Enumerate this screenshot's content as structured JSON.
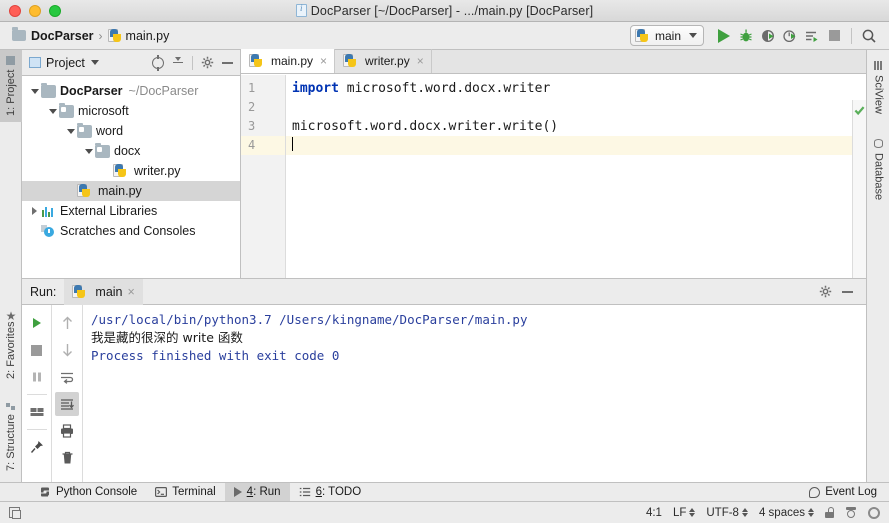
{
  "window": {
    "title": "DocParser [~/DocParser] - .../main.py [DocParser]",
    "title_icon": "file-info-icon",
    "traffic_lights": [
      "close-button",
      "minimize-button",
      "zoom-button"
    ],
    "colors": {
      "red": "#ff5f57",
      "yellow": "#febc2e",
      "green": "#28c840"
    }
  },
  "toolbar": {
    "breadcrumb": [
      {
        "icon": "project-folder-icon",
        "label": "DocParser"
      },
      {
        "icon": "python-file-icon",
        "label": "main.py"
      }
    ],
    "breadcrumb_separator": "›",
    "run_config": {
      "icon": "python-icon",
      "label": "main",
      "caret": "▾"
    },
    "buttons": [
      {
        "name": "run-button",
        "label": "Run"
      },
      {
        "name": "debug-button",
        "label": "Debug"
      },
      {
        "name": "run-with-coverage-button",
        "label": "Run with Coverage"
      },
      {
        "name": "profile-button",
        "label": "Profile"
      },
      {
        "name": "run-with-console-button",
        "label": "Run with Console"
      },
      {
        "name": "stop-button",
        "label": "Stop"
      },
      {
        "name": "search-everywhere-button",
        "label": "Search Everywhere"
      }
    ]
  },
  "left_strip": {
    "tabs": [
      {
        "label": "1: Project",
        "icon": "project-icon",
        "active": true
      },
      {
        "label": "2: Favorites",
        "icon": "star-icon",
        "active": false
      },
      {
        "label": "7: Structure",
        "icon": "structure-icon",
        "active": false
      }
    ]
  },
  "right_strip": {
    "tabs": [
      {
        "label": "SciView",
        "icon": "sciview-icon"
      },
      {
        "label": "Database",
        "icon": "database-icon"
      }
    ]
  },
  "project_panel": {
    "title": "Project",
    "title_caret": "▾",
    "actions": [
      {
        "name": "select-opened-file-button",
        "label": "Select Opened File"
      },
      {
        "name": "collapse-all-button",
        "label": "Collapse All"
      },
      {
        "name": "panel-settings-button",
        "label": "Settings"
      },
      {
        "name": "hide-panel-button",
        "label": "Hide"
      }
    ],
    "tree": [
      {
        "label": "DocParser",
        "path": "~/DocParser",
        "icon": "project-root-icon",
        "indent": 0,
        "arrow": "down",
        "bold": true,
        "selected": false
      },
      {
        "label": "microsoft",
        "path": "",
        "icon": "source-folder-icon",
        "indent": 1,
        "arrow": "down",
        "bold": false,
        "selected": false
      },
      {
        "label": "word",
        "path": "",
        "icon": "source-folder-icon",
        "indent": 2,
        "arrow": "down",
        "bold": false,
        "selected": false
      },
      {
        "label": "docx",
        "path": "",
        "icon": "source-folder-icon",
        "indent": 3,
        "arrow": "down",
        "bold": false,
        "selected": false
      },
      {
        "label": "writer.py",
        "path": "",
        "icon": "python-file-icon",
        "indent": 4,
        "arrow": "none",
        "bold": false,
        "selected": false
      },
      {
        "label": "main.py",
        "path": "",
        "icon": "python-file-icon",
        "indent": 2,
        "arrow": "none",
        "bold": false,
        "selected": true
      },
      {
        "label": "External Libraries",
        "path": "",
        "icon": "external-libraries-icon",
        "indent": 0,
        "arrow": "right",
        "bold": false,
        "selected": false
      },
      {
        "label": "Scratches and Consoles",
        "path": "",
        "icon": "scratches-icon",
        "indent": 0,
        "arrow": "none",
        "bold": false,
        "selected": false
      }
    ]
  },
  "editor": {
    "tabs": [
      {
        "label": "main.py",
        "icon": "python-file-icon",
        "active": true,
        "close": "×"
      },
      {
        "label": "writer.py",
        "icon": "python-file-icon",
        "active": false,
        "close": "×"
      }
    ],
    "gutter_lines": [
      "1",
      "2",
      "3",
      "4"
    ],
    "current_line": 4,
    "lines": [
      {
        "num": 1,
        "keyword": "import",
        "rest": " microsoft.word.docx.writer"
      },
      {
        "num": 2,
        "keyword": "",
        "rest": ""
      },
      {
        "num": 3,
        "keyword": "",
        "rest": "microsoft.word.docx.writer.write()"
      },
      {
        "num": 4,
        "keyword": "",
        "rest": ""
      }
    ],
    "inspection_status": "no-errors-check-icon"
  },
  "run_panel": {
    "label": "Run:",
    "tab": {
      "icon": "python-icon",
      "label": "main",
      "close": "×"
    },
    "actions": [
      {
        "name": "run-panel-settings-button",
        "label": "Settings"
      },
      {
        "name": "run-panel-hide-button",
        "label": "Hide"
      }
    ],
    "tools_left": [
      {
        "name": "rerun-button",
        "label": "Rerun"
      },
      {
        "name": "stop-process-button",
        "label": "Stop"
      },
      {
        "name": "pause-output-button",
        "label": "Pause Output"
      },
      {
        "name": "restore-layout-button",
        "label": "Restore Layout"
      },
      {
        "name": "pin-tab-button",
        "label": "Pin Tab"
      }
    ],
    "tools_right": [
      {
        "name": "up-stack-trace-button",
        "label": "Up the Stack Trace"
      },
      {
        "name": "down-stack-trace-button",
        "label": "Down the Stack Trace"
      },
      {
        "name": "soft-wrap-button",
        "label": "Use Soft Wraps"
      },
      {
        "name": "scroll-to-end-button",
        "label": "Scroll to End",
        "active": true
      },
      {
        "name": "print-button",
        "label": "Print"
      },
      {
        "name": "clear-all-button",
        "label": "Clear All"
      }
    ],
    "console": [
      {
        "text": "/usr/local/bin/python3.7 /Users/kingname/DocParser/main.py",
        "style": "blue"
      },
      {
        "text": "我是藏的很深的 write 函数",
        "style": "plain"
      },
      {
        "text": "",
        "style": "plain"
      },
      {
        "text": "Process finished with exit code 0",
        "style": "blue"
      }
    ]
  },
  "bottom_bar": {
    "tabs": [
      {
        "label": "Python Console",
        "icon": "python-console-icon",
        "active": false,
        "mnemonic": ""
      },
      {
        "label": "Terminal",
        "icon": "terminal-icon",
        "active": false,
        "mnemonic": ""
      },
      {
        "label": ": Run",
        "icon": "run-triangle-icon",
        "active": true,
        "mnemonic": "4"
      },
      {
        "label": ": TODO",
        "icon": "todo-list-icon",
        "active": false,
        "mnemonic": "6"
      }
    ],
    "event_log": {
      "label": "Event Log",
      "icon": "event-log-icon"
    }
  },
  "status_bar": {
    "left_icon": "show-tool-windows-icon",
    "caret_position": "4:1",
    "line_separator": "LF",
    "encoding": "UTF-8",
    "indent": "4 spaces",
    "lock_icon": "unlocked-icon",
    "hide_icon": "incognito-icon",
    "help_icon": "help-gear-icon"
  }
}
